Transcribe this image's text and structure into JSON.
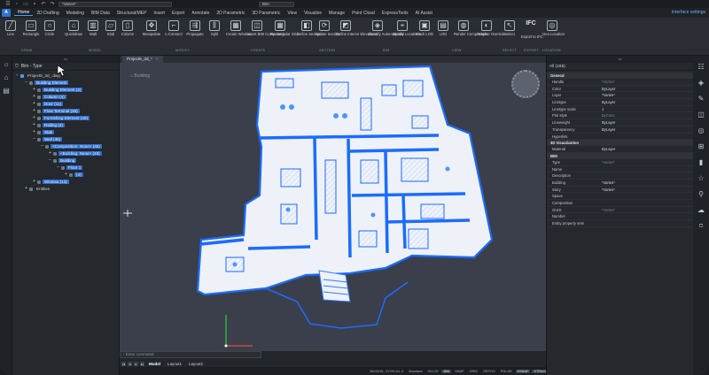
{
  "titlebar": {
    "varies": "*Varies*",
    "bim": "Bim"
  },
  "menubar": {
    "logo": "A",
    "tabs": [
      "Home",
      "2D Drafting",
      "Modeling",
      "BIM Data",
      "Structural/MEP",
      "Insert",
      "Export",
      "Annotate",
      "2D Parametric",
      "3D Parametric",
      "View",
      "Visualize",
      "Manage",
      "Point Cloud",
      "ExpressTools",
      "AI Assist"
    ],
    "interface_settings": "Interface settings"
  },
  "ribbon": {
    "buttons": [
      "Line",
      "Rectangle",
      "Circle",
      "Quickdraw",
      "Wall",
      "Slab",
      "Column",
      "Manipulate",
      "L-Connect",
      "Propagate",
      "Split",
      "Create Window",
      "Insert BIM Component",
      "Rectangular Grid",
      "Define Section",
      "Update Section",
      "Define Interior Elevations",
      "Classify Automatically",
      "Spatial Locations",
      "Block LOD",
      "LOD",
      "Render Composition",
      "Graphic Override",
      "Select",
      "Export to IFC",
      "Geo Location"
    ],
    "groups": [
      "DRAW",
      "MODEL",
      "MODIFY",
      "CREATE",
      "SECTION",
      "BIM",
      "VIEW",
      "SELECT",
      "EXPORT",
      "LOCATION"
    ],
    "ifc_label": "IFC"
  },
  "structure_panel": {
    "filter": "Bim - Type",
    "tree": [
      {
        "label": "Project5_3d_.dwg",
        "level": 0,
        "selected": false
      },
      {
        "label": "Building Element",
        "level": 1,
        "selected": true
      },
      {
        "label": "Building Element (4)",
        "level": 2,
        "selected": true
      },
      {
        "label": "Column (4)",
        "level": 2,
        "selected": true
      },
      {
        "label": "Door (11)",
        "level": 2,
        "selected": true
      },
      {
        "label": "Flow Terminal (36)",
        "level": 2,
        "selected": true
      },
      {
        "label": "Furnishing Element (40)",
        "level": 2,
        "selected": true
      },
      {
        "label": "Railing (2)",
        "level": 2,
        "selected": true
      },
      {
        "label": "Slab",
        "level": 2,
        "selected": true
      },
      {
        "label": "Wall (45)",
        "level": 2,
        "selected": true
      },
      {
        "label": "<Composition: None> (45)",
        "level": 3,
        "selected": true
      },
      {
        "label": "<Building: None> (45)",
        "level": 4,
        "selected": true
      },
      {
        "label": "Building",
        "level": 4,
        "selected": true
      },
      {
        "label": "Floor 1",
        "level": 5,
        "selected": true
      },
      {
        "label": "(4)",
        "level": 6,
        "selected": true
      },
      {
        "label": "Window (13)",
        "level": 2,
        "selected": true
      },
      {
        "label": "Entities",
        "level": 1,
        "selected": false
      }
    ]
  },
  "viewport": {
    "tab": "Project5_3d_*",
    "building_label": "Building",
    "command_placeholder": "Enter command",
    "layouts": [
      "Model",
      "Layout1",
      "Layout2"
    ]
  },
  "properties_panel": {
    "selection": "All (165)",
    "sections": [
      {
        "title": "General",
        "rows": [
          [
            "Handle",
            "*Varies*",
            true
          ],
          [
            "Color",
            "ByLayer",
            false
          ],
          [
            "Layer",
            "*Varies*",
            false
          ],
          [
            "Linetype",
            "ByLayer",
            false
          ],
          [
            "Linetype scale",
            "1",
            false
          ],
          [
            "Plot style",
            "ByColor",
            true
          ],
          [
            "Lineweight",
            "ByLayer",
            false
          ],
          [
            "Transparency",
            "ByLayer",
            false
          ],
          [
            "Hyperlink",
            "",
            false
          ]
        ]
      },
      {
        "title": "3D Visualization",
        "rows": [
          [
            "Material",
            "ByLayer",
            false
          ]
        ]
      },
      {
        "title": "BIM",
        "rows": [
          [
            "Type",
            "*Varies*",
            true
          ],
          [
            "Name",
            "",
            false
          ],
          [
            "Description",
            "",
            false
          ],
          [
            "Building",
            "*Varies*",
            false
          ],
          [
            "Story",
            "*Varies*",
            false
          ],
          [
            "Space",
            "",
            false
          ],
          [
            "Composition",
            "",
            false
          ],
          [
            "GUID",
            "*Varies*",
            true
          ],
          [
            "Number",
            "",
            false
          ],
          [
            "Entity property sets",
            "",
            false
          ]
        ]
      }
    ]
  },
  "statusbar": {
    "coords": "26018.81, 21709.44, 0",
    "items": [
      "Standard",
      "ISO-25",
      "BIM",
      "SNAP",
      "GRID",
      "ORTHO",
      "POLAR",
      "ESNAP",
      "STRACK",
      "LWT",
      "TILE",
      "DUCS",
      "DYN",
      "QUAD",
      "RT",
      "HKA",
      "LOCKUI",
      "None"
    ],
    "active": [
      "BIM",
      "ESNAP",
      "STRACK",
      "DYN",
      "QUAD",
      "RT",
      "HKA"
    ]
  },
  "colors": {
    "accent": "#2e6cc8",
    "viewport_bg": "#3b3f4b",
    "selection": "#3d87ff"
  }
}
